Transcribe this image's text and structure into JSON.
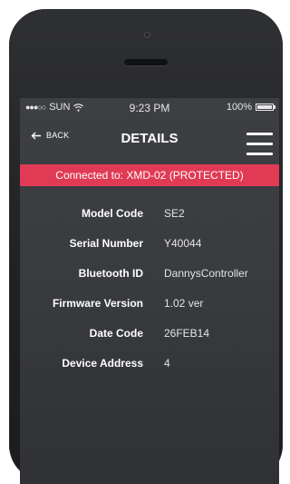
{
  "status_bar": {
    "signal": "●●●○○",
    "carrier": "SUN",
    "time": "9:23 PM",
    "battery": "100%"
  },
  "nav": {
    "back_label": "BACK",
    "title": "DETAILS"
  },
  "banner": {
    "text": "Connected to: XMD-02 (PROTECTED)",
    "color": "#e03a54"
  },
  "details": [
    {
      "label": "Model Code",
      "value": "SE2"
    },
    {
      "label": "Serial Number",
      "value": "Y40044"
    },
    {
      "label": "Bluetooth ID",
      "value": "DannysController"
    },
    {
      "label": "Firmware Version",
      "value": "1.02 ver"
    },
    {
      "label": "Date Code",
      "value": "26FEB14"
    },
    {
      "label": "Device Address",
      "value": "4"
    }
  ],
  "icons": {
    "wifi": "wifi-icon",
    "battery": "battery-icon",
    "back": "back-arrow-icon",
    "menu": "hamburger-menu-icon"
  }
}
